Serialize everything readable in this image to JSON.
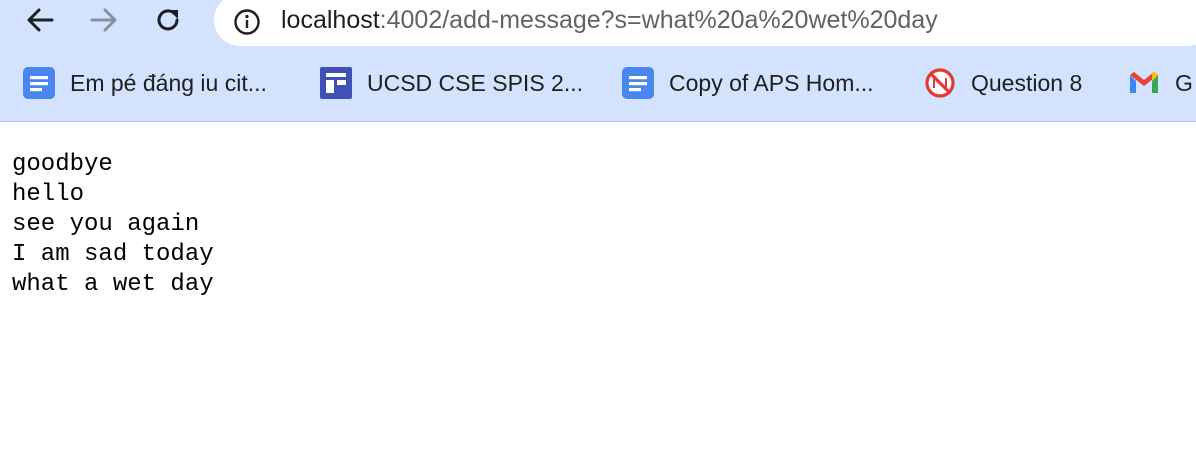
{
  "browser": {
    "url_host": "localhost",
    "url_rest": ":4002/add-message?s=what%20a%20wet%20day",
    "toolbar": {
      "back_icon": "arrow-left-icon",
      "forward_icon": "arrow-right-icon",
      "reload_icon": "reload-icon",
      "site_info_icon": "info-icon"
    },
    "bookmarks": [
      {
        "label": "Em pé đáng iu cit...",
        "icon": "google-docs-icon"
      },
      {
        "label": "UCSD CSE SPIS 2...",
        "icon": "google-sites-icon"
      },
      {
        "label": "Copy of APS Hom...",
        "icon": "google-docs-icon"
      },
      {
        "label": "Question 8",
        "icon": "no-symbol-icon"
      },
      {
        "label": "G",
        "icon": "gmail-icon"
      }
    ]
  },
  "page": {
    "messages": [
      "goodbye",
      "hello",
      "see you again",
      "I am sad today",
      "what a wet day"
    ]
  },
  "colors": {
    "chrome_bg": "#d3e3fd",
    "docs_blue": "#4a86f0",
    "sites_indigo": "#3f51b5",
    "no_symbol_red": "#e53935"
  }
}
